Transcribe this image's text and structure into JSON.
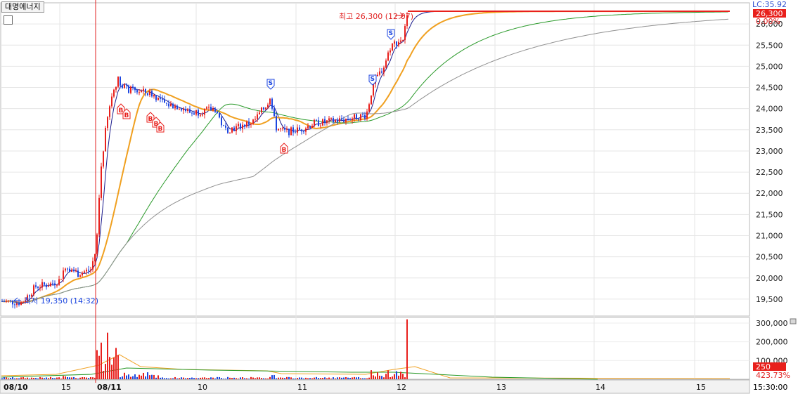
{
  "header": {
    "stock_name": "대명에너지",
    "lc_label": "LC:35.92"
  },
  "price_axis": {
    "ticks": [
      "26,000",
      "25,500",
      "25,000",
      "24,500",
      "24,000",
      "23,500",
      "23,000",
      "22,500",
      "22,000",
      "21,500",
      "21,000",
      "20,500",
      "20,000",
      "19,500"
    ],
    "current_price_tag": "26,300",
    "change_tag": "0.00%"
  },
  "volume_axis": {
    "ticks": [
      "300,000",
      "200,000",
      "100,000"
    ],
    "current_volume_tag": "250",
    "volume_ratio_tag": "423.73%"
  },
  "time_axis": {
    "labels": [
      "08/10",
      "15",
      "08/11",
      "10",
      "11",
      "12",
      "13",
      "14",
      "15"
    ],
    "clock": "15:30:00"
  },
  "annotations": {
    "high": "최고 26,300 (12:07)",
    "low": "최저 19,350 (14:32)",
    "buy_marker": "B",
    "sell_marker": "S"
  },
  "colors": {
    "up": "#e8201c",
    "down": "#1c46e0",
    "ma5": "#1a1a8c",
    "ma20": "#f0a020",
    "ma60": "#2a9a2a",
    "ma120": "#909090",
    "session_line": "#e02020"
  },
  "chart_data": {
    "type": "candlestick",
    "x": [
      "08/10 14:00",
      "08/10 15:00",
      "08/11 09:00",
      "08/11 09:30",
      "08/11 10:00",
      "08/11 10:30",
      "08/11 11:00",
      "08/11 11:30",
      "08/11 12:00",
      "08/11 12:07"
    ],
    "close": [
      19400,
      19900,
      24300,
      24100,
      23500,
      23900,
      24200,
      23600,
      23800,
      26300
    ],
    "ylim": [
      19100,
      26500
    ],
    "high": 26300,
    "low": 19350,
    "volume_ylim": [
      0,
      330000
    ]
  }
}
